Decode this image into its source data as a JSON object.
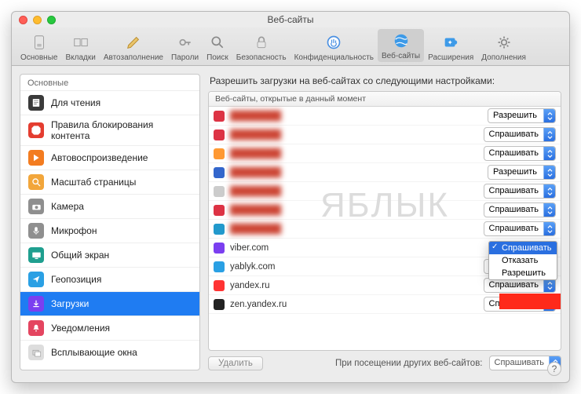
{
  "window": {
    "title": "Веб-сайты"
  },
  "toolbar": {
    "items": [
      {
        "label": "Основные"
      },
      {
        "label": "Вкладки"
      },
      {
        "label": "Автозаполнение"
      },
      {
        "label": "Пароли"
      },
      {
        "label": "Поиск"
      },
      {
        "label": "Безопасность"
      },
      {
        "label": "Конфиденциальность"
      },
      {
        "label": "Веб-сайты"
      },
      {
        "label": "Расширения"
      },
      {
        "label": "Дополнения"
      }
    ],
    "active_index": 7
  },
  "sidebar": {
    "group_title": "Основные",
    "items": [
      {
        "label": "Для чтения",
        "icon": "reader",
        "color": "#3a3a3a"
      },
      {
        "label": "Правила блокирования контента",
        "icon": "stop",
        "color": "#e43d30"
      },
      {
        "label": "Автовоспроизведение",
        "icon": "play",
        "color": "#f37c20"
      },
      {
        "label": "Масштаб страницы",
        "icon": "zoom",
        "color": "#f2a63b"
      },
      {
        "label": "Камера",
        "icon": "camera",
        "color": "#8f8f8f"
      },
      {
        "label": "Микрофон",
        "icon": "mic",
        "color": "#8f8f8f"
      },
      {
        "label": "Общий экран",
        "icon": "screen",
        "color": "#1f9f8f"
      },
      {
        "label": "Геопозиция",
        "icon": "arrow",
        "color": "#2aa0e4"
      },
      {
        "label": "Загрузки",
        "icon": "download",
        "color": "#7b3ff0"
      },
      {
        "label": "Уведомления",
        "icon": "bell",
        "color": "#e44560"
      },
      {
        "label": "Всплывающие окна",
        "icon": "popup",
        "color": "#dddddd"
      }
    ],
    "selected_index": 8
  },
  "main": {
    "title": "Разрешить загрузки на веб-сайтах со следующими настройками:",
    "table_header": "Веб-сайты, открытые в данный момент",
    "rows": [
      {
        "host": "████████",
        "blur": true,
        "value": "Разрешить",
        "fav": "#d34"
      },
      {
        "host": "████████",
        "blur": true,
        "value": "Спрашивать",
        "fav": "#d34"
      },
      {
        "host": "████████",
        "blur": true,
        "value": "Спрашивать",
        "fav": "#f93"
      },
      {
        "host": "████████",
        "blur": true,
        "value": "Разрешить",
        "fav": "#36c"
      },
      {
        "host": "████████",
        "blur": true,
        "value": "Спрашивать",
        "fav": "#ccc"
      },
      {
        "host": "████████",
        "blur": true,
        "value": "Спрашивать",
        "fav": "#d34"
      },
      {
        "host": "████████",
        "blur": true,
        "value": "Спрашивать",
        "fav": "#29c"
      },
      {
        "host": "viber.com",
        "blur": false,
        "value": "Спрашивать",
        "fav": "#7b3ff0"
      },
      {
        "host": "yablyk.com",
        "blur": false,
        "value": "Спрашивать",
        "fav": "#2aa0e4"
      },
      {
        "host": "yandex.ru",
        "blur": false,
        "value": "Спрашивать",
        "fav": "#f33"
      },
      {
        "host": "zen.yandex.ru",
        "blur": false,
        "value": "Спрашивать",
        "fav": "#222"
      }
    ],
    "dropdown": {
      "options": [
        "Спрашивать",
        "Отказать",
        "Разрешить"
      ],
      "selected_index": 0
    },
    "delete_button": "Удалить",
    "footer_label": "При посещении других веб-сайтов:",
    "footer_value": "Спрашивать"
  },
  "watermark": "ЯБЛЫК",
  "help": "?"
}
